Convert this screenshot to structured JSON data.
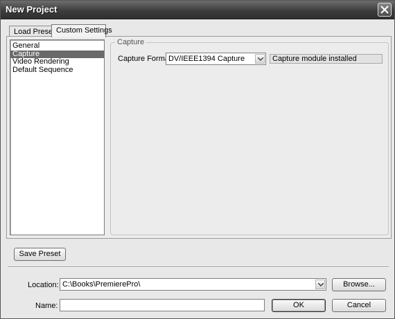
{
  "window": {
    "title": "New Project"
  },
  "tabs": [
    {
      "label": "Load Preset"
    },
    {
      "label": "Custom Settings"
    }
  ],
  "categories": [
    {
      "label": "General"
    },
    {
      "label": "Capture"
    },
    {
      "label": "Video Rendering"
    },
    {
      "label": "Default Sequence"
    }
  ],
  "selected_category": "Capture",
  "capture": {
    "group_title": "Capture",
    "format_label": "Capture Format:",
    "format_value": "DV/IEEE1394 Capture",
    "status_text": "Capture module installed"
  },
  "buttons": {
    "save_preset": "Save Preset",
    "browse": "Browse...",
    "ok": "OK",
    "cancel": "Cancel"
  },
  "location": {
    "label": "Location:",
    "value": "C:\\Books\\PremierePro\\"
  },
  "name": {
    "label": "Name:",
    "value": ""
  },
  "icons": {
    "close": "close-icon",
    "dropdown": "chevron-down-icon"
  },
  "colors": {
    "titlebar": "#3d3d3d",
    "selection": "#6a6a6a",
    "dialog_bg": "#e8e8e8"
  }
}
